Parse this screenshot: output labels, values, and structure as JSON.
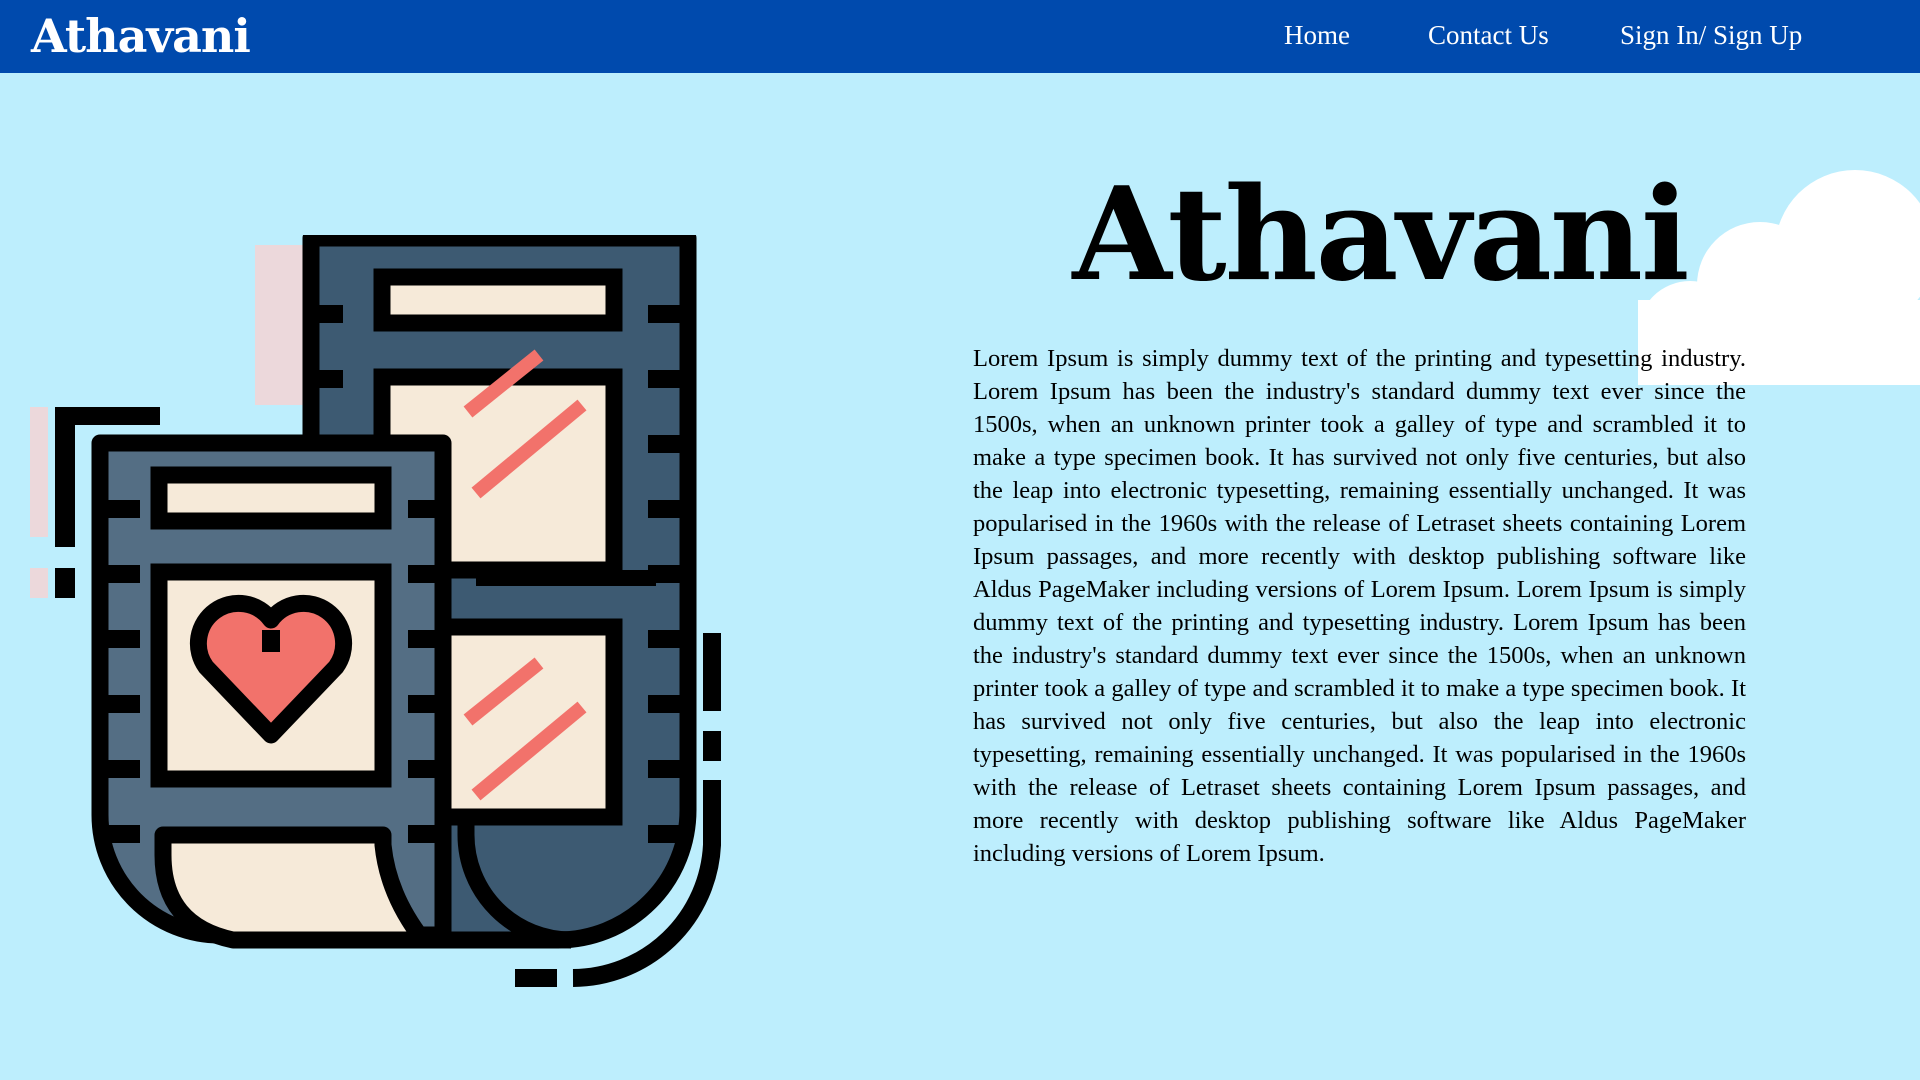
{
  "header": {
    "brand": "Athavani",
    "nav": {
      "home": "Home",
      "contact": "Contact Us",
      "signin": "Sign In/ Sign Up"
    }
  },
  "hero": {
    "title": "Athavani",
    "body": "Lorem Ipsum is simply dummy text of the printing and typesetting industry. Lorem Ipsum has been the industry's standard dummy text ever since the 1500s, when an unknown printer took a galley of type and scrambled it to make a type specimen book. It has survived not only five centuries, but also the leap into electronic typesetting, remaining essentially unchanged. It was popularised in the 1960s with the release of Letraset sheets containing Lorem Ipsum passages, and more recently with desktop publishing software like Aldus PageMaker including versions of Lorem Ipsum. Lorem Ipsum is simply dummy text of the printing and typesetting industry. Lorem Ipsum has been the industry's standard dummy text ever since the 1500s, when an unknown printer took a galley of type and scrambled it to make a type specimen book. It has survived not only five centuries, but also the leap into electronic typesetting, remaining essentially unchanged. It was popularised in the 1960s with the release of Letraset sheets containing Lorem Ipsum passages, and more recently with desktop publishing software like Aldus PageMaker including versions of Lorem Ipsum."
  },
  "colors": {
    "navbar": "#004aad",
    "page_background": "#bdeefd",
    "film_dark": "#3d5a72",
    "film_light": "#546e84",
    "paper": "#f6ead9",
    "accent_red": "#f2726b",
    "shadow_pink": "#ecd8db"
  },
  "icons": {
    "illustration": "film-reel-heart-icon",
    "cloud": "cloud-icon"
  }
}
